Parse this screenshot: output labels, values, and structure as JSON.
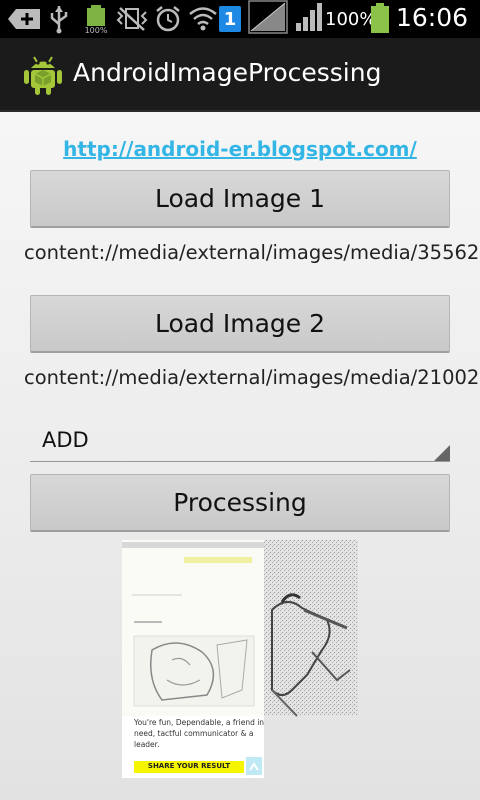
{
  "status_bar": {
    "sim_number": "1",
    "battery_small_label": "100%",
    "battery_percent": "100%",
    "time": "16:06",
    "battery_level": 1.0
  },
  "action_bar": {
    "title": "AndroidImageProcessing"
  },
  "main": {
    "link": "http://android-er.blogspot.com/",
    "load_image_1_label": "Load Image 1",
    "image_1_uri": "content://media/external/images/media/35562",
    "load_image_2_label": "Load Image 2",
    "image_2_uri": "content://media/external/images/media/21002",
    "operation_selected": "ADD",
    "processing_label": "Processing",
    "result_image": {
      "text_line_1": "You're fun, Dependable, a friend in",
      "text_line_2": "need, tactful communicator & a",
      "text_line_3": "leader.",
      "button_text": "SHARE YOUR RESULT"
    }
  },
  "colors": {
    "link": "#33b5e5",
    "status_bar": "#000000",
    "action_bar": "#1b1b1b",
    "android_green": "#a4c639",
    "battery_green": "#8bc34a"
  }
}
